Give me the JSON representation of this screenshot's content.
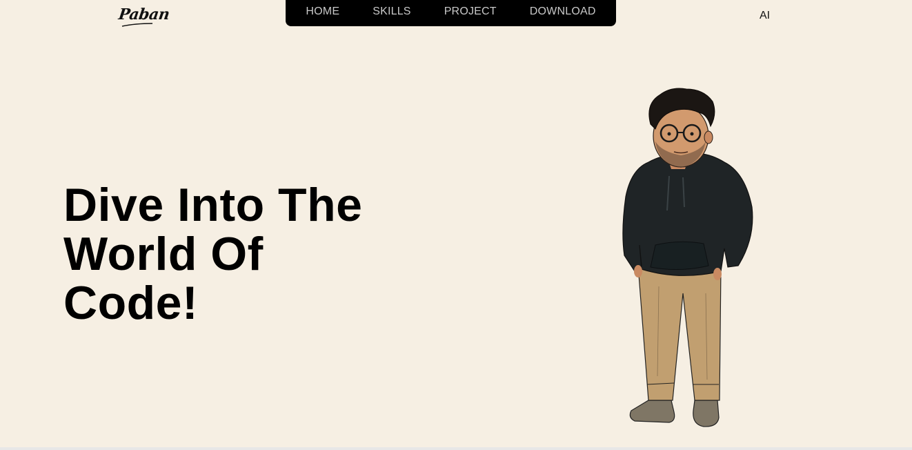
{
  "header": {
    "logo_text": "Paban",
    "nav": [
      {
        "label": "HOME"
      },
      {
        "label": "SKILLS"
      },
      {
        "label": "PROJECT"
      },
      {
        "label": "DOWNLOAD"
      }
    ],
    "ai_link": "AI"
  },
  "hero": {
    "title": "Dive Into The World Of Code!"
  },
  "colors": {
    "background": "#f6efe3",
    "navbar": "#000000",
    "nav_text": "#c9c9c9",
    "hoodie": "#1f2426",
    "pants": "#c19f70",
    "shoes": "#7f7665"
  },
  "icons": {
    "avatar": "developer-avatar-illustration"
  }
}
